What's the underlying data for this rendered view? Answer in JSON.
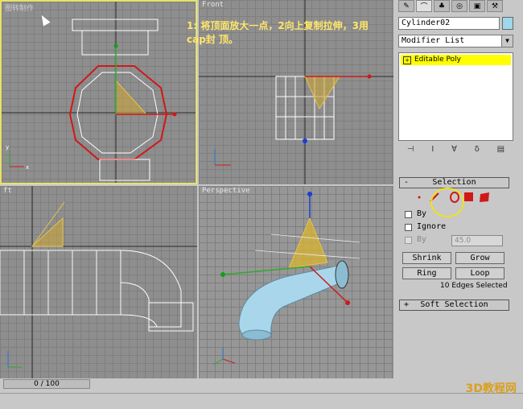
{
  "viewports": {
    "top": {
      "label": "图转制作",
      "x_axis": "x",
      "y_axis": "y"
    },
    "front": {
      "label": "Front",
      "x_axis": "x",
      "y_axis": "z"
    },
    "left": {
      "label": "ft",
      "x_axis": "y",
      "y_axis": "z"
    },
    "perspective": {
      "label": "Perspective",
      "x_axis": "x",
      "y_axis": "y",
      "z_axis": "z"
    }
  },
  "annotation": "1: 将顶面放大一点，2向上复制拉伸，3用cap封 顶。",
  "panel": {
    "tab_icons": [
      "create-icon",
      "modify-icon",
      "hierarchy-icon",
      "motion-icon",
      "display-icon",
      "utilities-icon"
    ],
    "object_name": "Cylinder02",
    "color": "#9fd8ec",
    "modifier_list": "Modifier List",
    "stack_item": "Editable Poly",
    "selection_title": "Selection",
    "soft_selection_title": "Soft Selection",
    "by_vertex": "By",
    "ignore_backfacing": "Ignore",
    "by_angle": "By",
    "angle_value": "45.0",
    "shrink": "Shrink",
    "grow": "Grow",
    "ring": "Ring",
    "loop": "Loop",
    "status": "10 Edges Selected"
  },
  "timeline": {
    "frame": "0 / 100"
  },
  "watermark": "3D教程网"
}
